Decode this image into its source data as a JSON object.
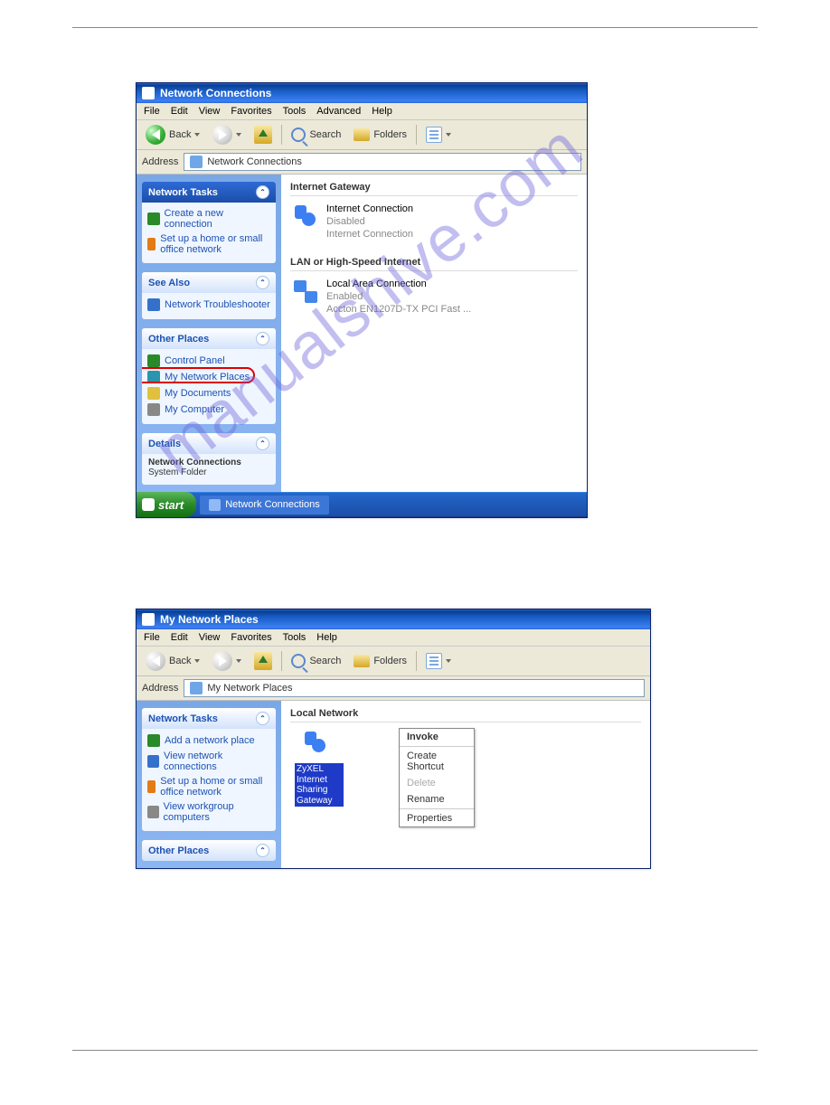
{
  "watermark": "manualshive.com",
  "win1": {
    "title": "Network Connections",
    "menus": [
      "File",
      "Edit",
      "View",
      "Favorites",
      "Tools",
      "Advanced",
      "Help"
    ],
    "toolbar": {
      "back": "Back",
      "search": "Search",
      "folders": "Folders"
    },
    "address_label": "Address",
    "address_value": "Network Connections",
    "sidebar": {
      "tasks_hd": "Network Tasks",
      "tasks": [
        "Create a new connection",
        "Set up a home or small office network"
      ],
      "seealso_hd": "See Also",
      "seealso": [
        "Network Troubleshooter"
      ],
      "other_hd": "Other Places",
      "other": [
        "Control Panel",
        "My Network Places",
        "My Documents",
        "My Computer"
      ],
      "details_hd": "Details",
      "details_title": "Network Connections",
      "details_sub": "System Folder"
    },
    "groups": {
      "gateway_hd": "Internet Gateway",
      "gateway_item": {
        "name": "Internet Connection",
        "status": "Disabled",
        "sub": "Internet Connection"
      },
      "lan_hd": "LAN or High-Speed Internet",
      "lan_item": {
        "name": "Local Area Connection",
        "status": "Enabled",
        "sub": "Accton EN1207D-TX PCI Fast ..."
      }
    },
    "taskbar": {
      "start": "start",
      "tab": "Network Connections"
    }
  },
  "win2": {
    "title": "My Network Places",
    "menus": [
      "File",
      "Edit",
      "View",
      "Favorites",
      "Tools",
      "Help"
    ],
    "toolbar": {
      "back": "Back",
      "search": "Search",
      "folders": "Folders"
    },
    "address_label": "Address",
    "address_value": "My Network Places",
    "sidebar": {
      "tasks_hd": "Network Tasks",
      "tasks": [
        "Add a network place",
        "View network connections",
        "Set up a home or small office network",
        "View workgroup computers"
      ],
      "other_hd": "Other Places"
    },
    "content": {
      "group_hd": "Local Network",
      "item_label": "ZyXEL Internet Sharing Gateway"
    },
    "context_menu": [
      "Invoke",
      "Create Shortcut",
      "Delete",
      "Rename",
      "Properties"
    ]
  }
}
